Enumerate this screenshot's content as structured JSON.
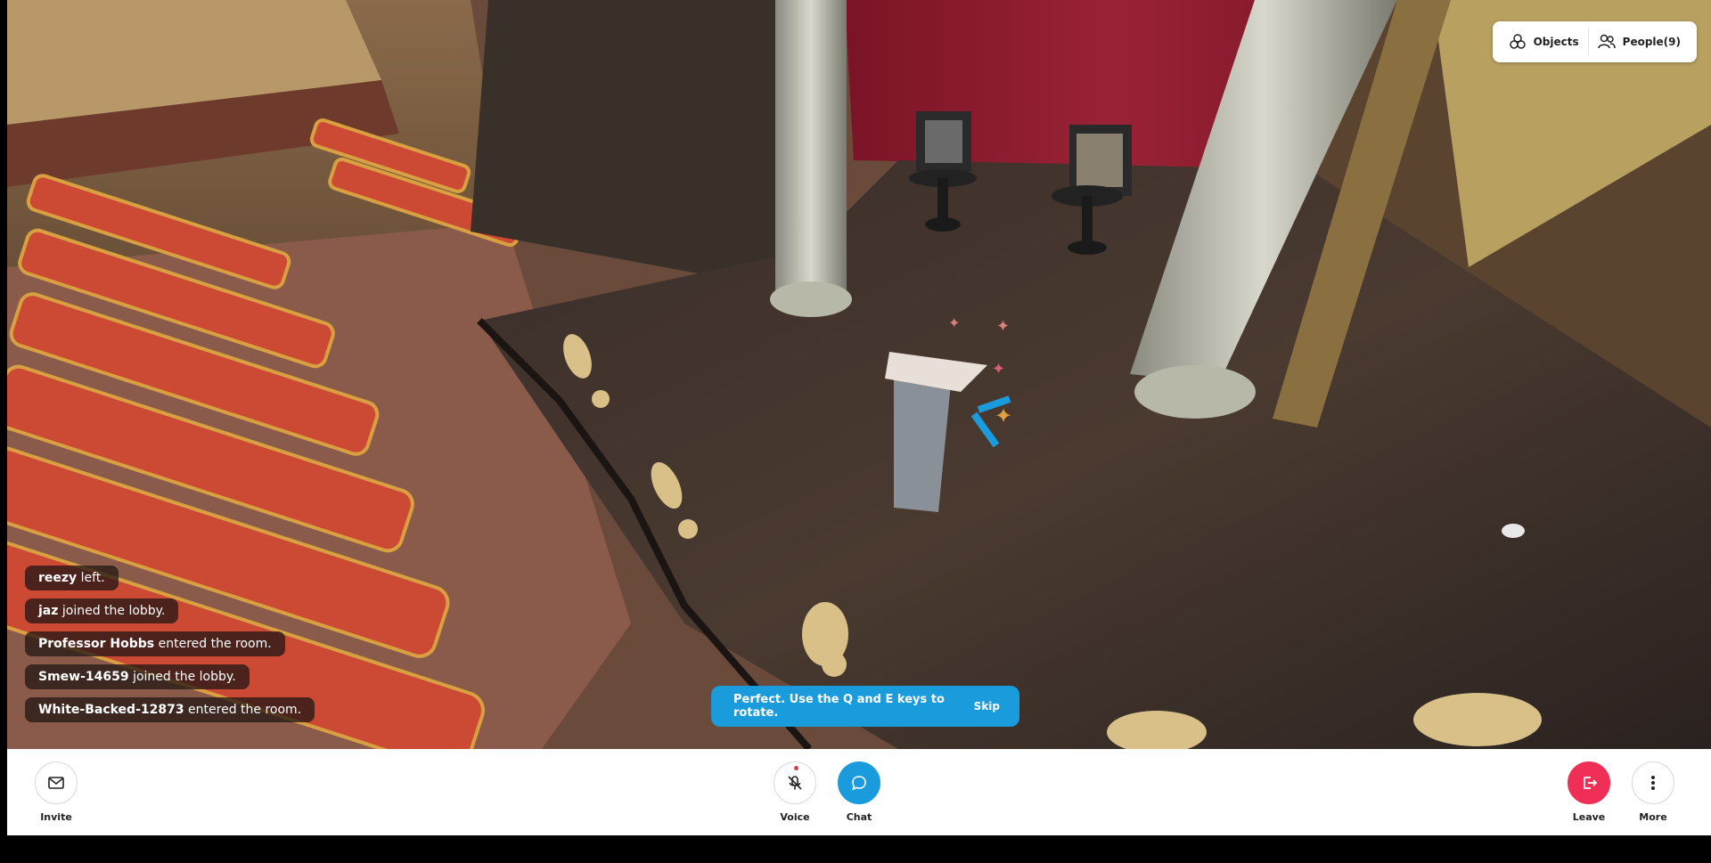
{
  "top_panel": {
    "objects_label": "Objects",
    "people_label": "People(9)"
  },
  "notifications": [
    {
      "name": "reezy",
      "message": "left."
    },
    {
      "name": "jaz",
      "message": "joined the lobby."
    },
    {
      "name": "Professor Hobbs",
      "message": "entered the room."
    },
    {
      "name": "Smew-14659",
      "message": "joined the lobby."
    },
    {
      "name": "White-Backed-12873",
      "message": "entered the room."
    }
  ],
  "tip": {
    "text": "Perfect. Use the Q and E keys to rotate.",
    "skip_label": "Skip"
  },
  "toolbar": {
    "invite_label": "Invite",
    "voice_label": "Voice",
    "chat_label": "Chat",
    "leave_label": "Leave",
    "more_label": "More"
  },
  "colors": {
    "accent_blue": "#1a9bdc",
    "leave_red": "#ef2f56",
    "curtain_red": "#8a1a2e",
    "seat_orange": "#d0503a"
  }
}
